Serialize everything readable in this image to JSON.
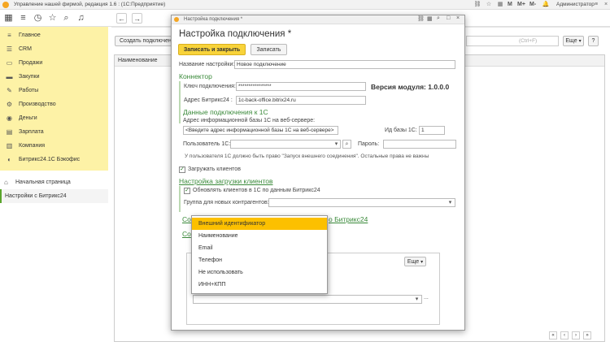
{
  "window": {
    "title": "Управление нашей фирмой, редакция 1.6 : (1С:Предприятие)",
    "user": "Администратор",
    "m_buttons": [
      "M",
      "M+",
      "M-"
    ]
  },
  "sidebar": {
    "items": [
      {
        "label": "Главное",
        "icon": "list-icon"
      },
      {
        "label": "CRM",
        "icon": "crm-icon"
      },
      {
        "label": "Продажи",
        "icon": "sales-icon"
      },
      {
        "label": "Закупки",
        "icon": "purchase-icon"
      },
      {
        "label": "Работы",
        "icon": "work-icon"
      },
      {
        "label": "Производство",
        "icon": "production-icon"
      },
      {
        "label": "Деньги",
        "icon": "money-icon"
      },
      {
        "label": "Зарплата",
        "icon": "salary-icon"
      },
      {
        "label": "Компания",
        "icon": "company-icon"
      },
      {
        "label": "Битрикс24.1С Бэкофис",
        "icon": "bitrix-icon"
      }
    ],
    "home": "Начальная страница",
    "current": "Настройки с Битрикс24"
  },
  "main": {
    "create_button": "Создать подключени",
    "search_hint": "(Ctrl+F)",
    "more_button": "Еще",
    "column_name": "Наименование"
  },
  "dialog": {
    "titlebar": "Настройка подключения *",
    "heading": "Настройка подключения *",
    "save_close": "Записать и закрыть",
    "save": "Записать",
    "name_label": "Название настройки:",
    "name_value": "Новое подключение",
    "connector_section": "Коннектор",
    "key_label": "Ключ подключения:",
    "key_value": "****************",
    "module_version": "Версия модуля: 1.0.0.0",
    "bitrix_addr_label": "Адрес Битрикс24 :",
    "bitrix_addr_value": "1c-back-office.bitrix24.ru",
    "data_section": "Данные подключения к 1С",
    "ib_addr_label": "Адрес информационной базы 1С на веб-сервере:",
    "ib_addr_value": "<Введите адрес информационной базы 1С на веб-сервере>",
    "ib_id_label": "Ид базы 1С:",
    "ib_id_value": "1",
    "user_label": "Пользователь 1С:",
    "password_label": "Пароль:",
    "user_note": "У пользователя 1С должно быть право \"Запуск внешнего соединения\". Остальные права не важны",
    "load_clients_label": "Загружать клиентов",
    "load_clients_checked": true,
    "clients_section": "Настройка загрузки клиентов",
    "update_clients_label": "Обновлять клиентов в 1С по данным Битрикс24",
    "update_clients_checked": true,
    "group_label": "Группа для новых контрагентов:",
    "link_partial_left": "Со",
    "link_partial_right": "о Битрикс24",
    "link2_partial": "Со",
    "more_button": "Еще",
    "dots": "..."
  },
  "dropdown": {
    "options": [
      "Внешний идентификатор",
      "Наименование",
      "Email",
      "Телефон",
      "Не использовать",
      "ИНН+КПП"
    ],
    "selected_index": 0,
    "selected_color": "#fcc000"
  },
  "colors": {
    "sidebar_bg": "#fdf2a6",
    "primary_button": "#f8d33a",
    "section_green": "#3a8a3a"
  }
}
